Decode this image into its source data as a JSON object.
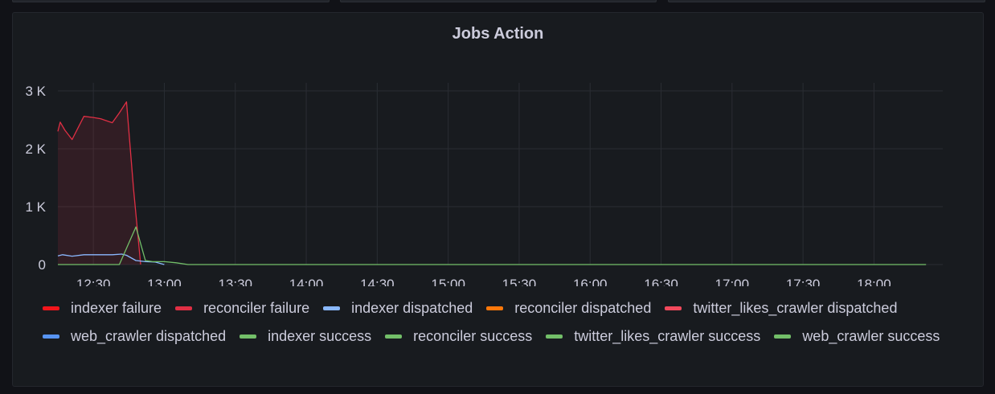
{
  "panel": {
    "title": "Jobs Action"
  },
  "chart_data": {
    "type": "line",
    "title": "Jobs Action",
    "xlabel": "",
    "ylabel": "",
    "ylim": [
      0,
      3000
    ],
    "xlim": [
      "12:15",
      "18:25"
    ],
    "x_ticks": [
      "12:30",
      "13:00",
      "13:30",
      "14:00",
      "14:30",
      "15:00",
      "15:30",
      "16:00",
      "16:30",
      "17:00",
      "17:30",
      "18:00"
    ],
    "y_ticks": [
      {
        "value": 0,
        "label": "0"
      },
      {
        "value": 1000,
        "label": "1 K"
      },
      {
        "value": 2000,
        "label": "2 K"
      },
      {
        "value": 3000,
        "label": "3 K"
      }
    ],
    "grid": true,
    "legend_position": "bottom",
    "series": [
      {
        "name": "indexer failure",
        "color": "#f2151b",
        "fill": true,
        "points": []
      },
      {
        "name": "reconciler failure",
        "color": "#e02f44",
        "fill": true,
        "points": [
          [
            "12:15",
            2300
          ],
          [
            "12:16",
            2460
          ],
          [
            "12:18",
            2320
          ],
          [
            "12:21",
            2160
          ],
          [
            "12:26",
            2560
          ],
          [
            "12:30",
            2540
          ],
          [
            "12:33",
            2520
          ],
          [
            "12:38",
            2450
          ],
          [
            "12:41",
            2620
          ],
          [
            "12:44",
            2810
          ],
          [
            "12:47",
            1300
          ],
          [
            "12:50",
            0
          ]
        ]
      },
      {
        "name": "indexer dispatched",
        "color": "#8ab8ff",
        "fill": false,
        "points": [
          [
            "12:15",
            150
          ],
          [
            "12:17",
            170
          ],
          [
            "12:21",
            145
          ],
          [
            "12:26",
            170
          ],
          [
            "12:34",
            170
          ],
          [
            "12:38",
            170
          ],
          [
            "12:42",
            180
          ],
          [
            "12:44",
            160
          ],
          [
            "12:48",
            70
          ],
          [
            "12:52",
            50
          ],
          [
            "12:56",
            45
          ],
          [
            "13:00",
            0
          ]
        ]
      },
      {
        "name": "reconciler dispatched",
        "color": "#ff780a",
        "fill": false,
        "points": []
      },
      {
        "name": "twitter_likes_crawler dispatched",
        "color": "#f2495c",
        "fill": false,
        "points": []
      },
      {
        "name": "web_crawler dispatched",
        "color": "#5794f2",
        "fill": false,
        "points": []
      },
      {
        "name": "indexer success",
        "color": "#73bf69",
        "fill": false,
        "points": [
          [
            "12:15",
            0
          ],
          [
            "12:41",
            0
          ],
          [
            "12:48",
            650
          ],
          [
            "12:52",
            70
          ],
          [
            "12:55",
            50
          ],
          [
            "13:00",
            50
          ],
          [
            "13:05",
            30
          ],
          [
            "13:10",
            0
          ],
          [
            "18:22",
            0
          ]
        ]
      },
      {
        "name": "reconciler success",
        "color": "#73bf69",
        "fill": false,
        "points": []
      },
      {
        "name": "twitter_likes_crawler success",
        "color": "#73bf69",
        "fill": false,
        "points": []
      },
      {
        "name": "web_crawler success",
        "color": "#73bf69",
        "fill": false,
        "points": []
      }
    ]
  }
}
